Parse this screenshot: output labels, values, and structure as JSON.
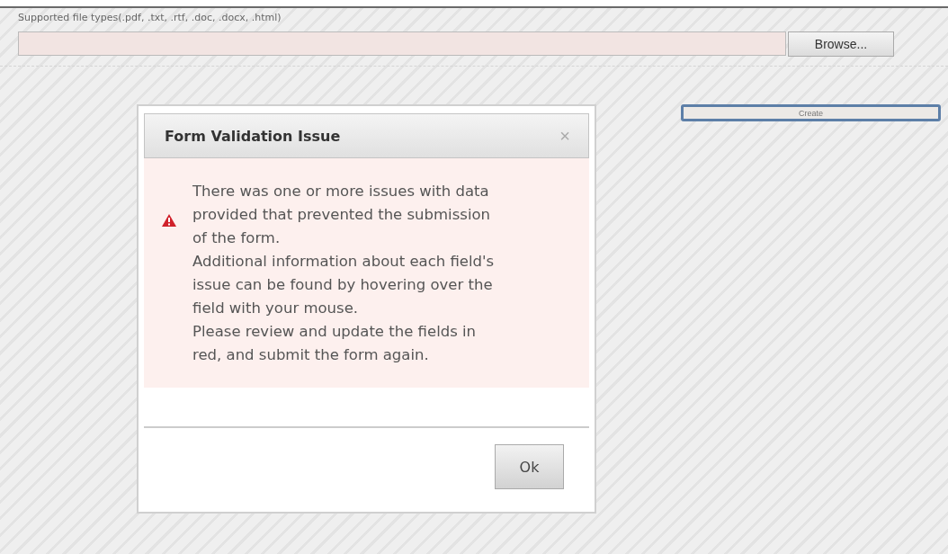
{
  "upload": {
    "label": "Supported file types(.pdf, .txt, .rtf, .doc, .docx, .html)",
    "invalid": true,
    "browse_button": "Browse..."
  },
  "create_button": "Create",
  "dialog": {
    "title": "Form Validation Issue",
    "close": "×",
    "error": true,
    "paragraphs": [
      "There was one or more issues with data provided that prevented the submission of the form.",
      "Additional information about each field's issue can be found by hovering over the field with your mouse.",
      "Please review and update the fields in red, and submit the form again."
    ],
    "button": "Ok"
  }
}
